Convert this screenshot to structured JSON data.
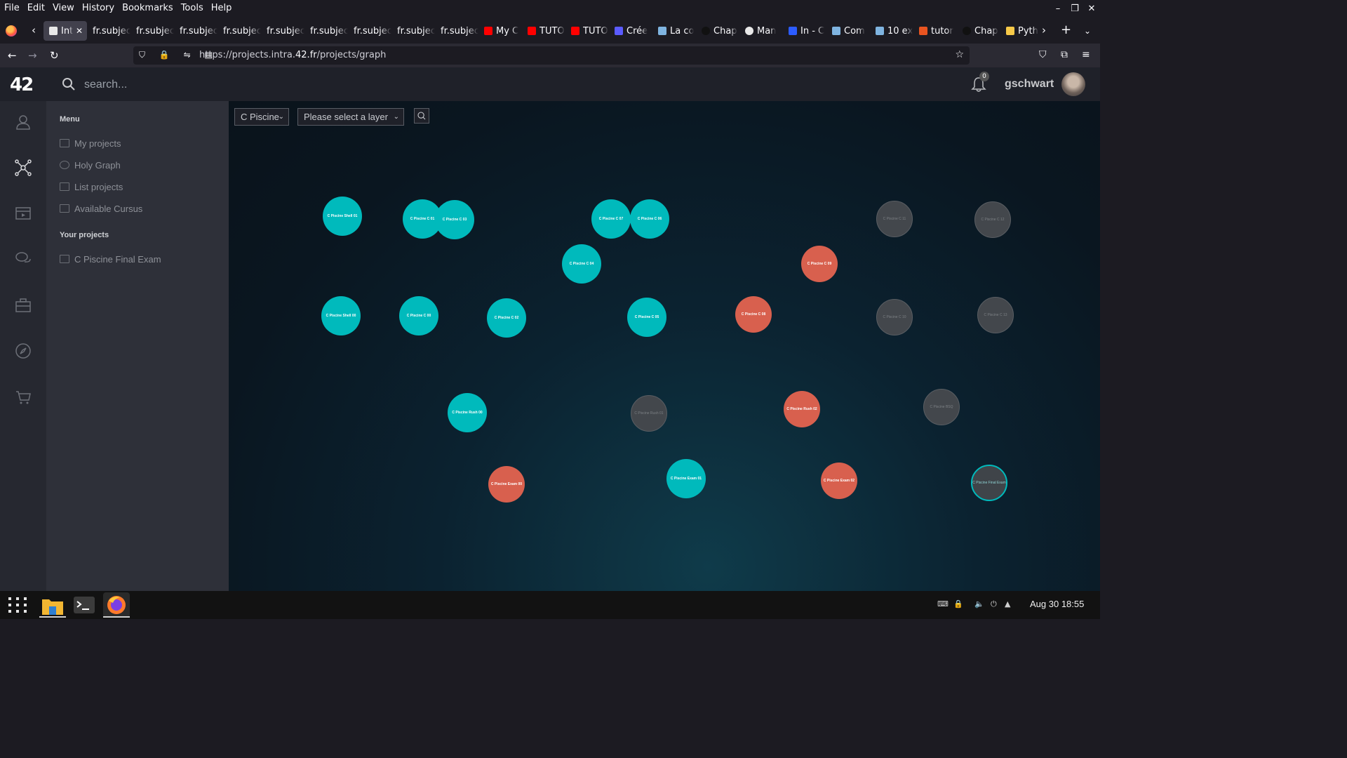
{
  "browser": {
    "menu": [
      "File",
      "Edit",
      "View",
      "History",
      "Bookmarks",
      "Tools",
      "Help"
    ],
    "tabs": [
      {
        "label": "Int",
        "favicon": "42-icon",
        "active": true
      },
      {
        "label": "fr.subjec",
        "favicon": "none"
      },
      {
        "label": "fr.subjec",
        "favicon": "none"
      },
      {
        "label": "fr.subjec",
        "favicon": "none"
      },
      {
        "label": "fr.subjec",
        "favicon": "none"
      },
      {
        "label": "fr.subjec",
        "favicon": "none"
      },
      {
        "label": "fr.subjec",
        "favicon": "none"
      },
      {
        "label": "fr.subjec",
        "favicon": "none"
      },
      {
        "label": "fr.subjec",
        "favicon": "none"
      },
      {
        "label": "fr.subjec",
        "favicon": "none"
      },
      {
        "label": "My C",
        "favicon": "youtube-icon"
      },
      {
        "label": "TUTO",
        "favicon": "youtube-icon"
      },
      {
        "label": "TUTO",
        "favicon": "youtube-icon"
      },
      {
        "label": "Crée",
        "favicon": "d-icon"
      },
      {
        "label": "La co",
        "favicon": "doc-icon"
      },
      {
        "label": "Chap",
        "favicon": "openai-icon"
      },
      {
        "label": "Man",
        "favicon": "github-icon"
      },
      {
        "label": "In - C",
        "favicon": "io-icon"
      },
      {
        "label": "Com",
        "favicon": "doc-icon"
      },
      {
        "label": "10 ex",
        "favicon": "doc-icon"
      },
      {
        "label": "tutor",
        "favicon": "ubuntu-icon"
      },
      {
        "label": "Chap",
        "favicon": "openai-icon"
      },
      {
        "label": "Pyth",
        "favicon": "python-icon"
      }
    ],
    "url_prefix": "https://projects.intra.",
    "url_domain": "42.fr",
    "url_suffix": "/projects/graph"
  },
  "page": {
    "logo": "42",
    "search_placeholder": "search...",
    "notifications_count": "0",
    "username": "gschwart",
    "menu_heading": "Menu",
    "menu_items": [
      "My projects",
      "Holy Graph",
      "List projects",
      "Available Cursus"
    ],
    "projects_heading": "Your projects",
    "project_items": [
      "C Piscine Final Exam"
    ],
    "cursus_select": "C Piscine",
    "layer_select": "Please select a layer"
  },
  "graph_nodes": [
    {
      "label": "C Piscine Shell 01",
      "status": "done"
    },
    {
      "label": "C Piscine C 01",
      "status": "done"
    },
    {
      "label": "C Piscine C 03",
      "status": "done"
    },
    {
      "label": "C Piscine C 07",
      "status": "done"
    },
    {
      "label": "C Piscine C 06",
      "status": "done"
    },
    {
      "label": "C Piscine C 11",
      "status": "locked"
    },
    {
      "label": "C Piscine C 12",
      "status": "locked"
    },
    {
      "label": "C Piscine C 04",
      "status": "done"
    },
    {
      "label": "C Piscine C 09",
      "status": "fail"
    },
    {
      "label": "C Piscine Shell 00",
      "status": "done"
    },
    {
      "label": "C Piscine C 00",
      "status": "done"
    },
    {
      "label": "C Piscine C 02",
      "status": "done"
    },
    {
      "label": "C Piscine C 05",
      "status": "done"
    },
    {
      "label": "C Piscine C 08",
      "status": "fail"
    },
    {
      "label": "C Piscine C 10",
      "status": "locked"
    },
    {
      "label": "C Piscine C 13",
      "status": "locked"
    },
    {
      "label": "C Piscine Rush 00",
      "status": "done"
    },
    {
      "label": "C Piscine Rush 01",
      "status": "locked"
    },
    {
      "label": "C Piscine Rush 02",
      "status": "fail"
    },
    {
      "label": "C Piscine BSQ",
      "status": "locked"
    },
    {
      "label": "C Piscine Exam 00",
      "status": "fail"
    },
    {
      "label": "C Piscine Exam 01",
      "status": "done"
    },
    {
      "label": "C Piscine Exam 02",
      "status": "fail"
    },
    {
      "label": "C Piscine Final Exam",
      "status": "current"
    }
  ],
  "colors": {
    "done": "#00babc",
    "fail": "#d8604e",
    "locked": "#43474c"
  },
  "taskbar": {
    "clock": "Aug 30  18:55"
  }
}
